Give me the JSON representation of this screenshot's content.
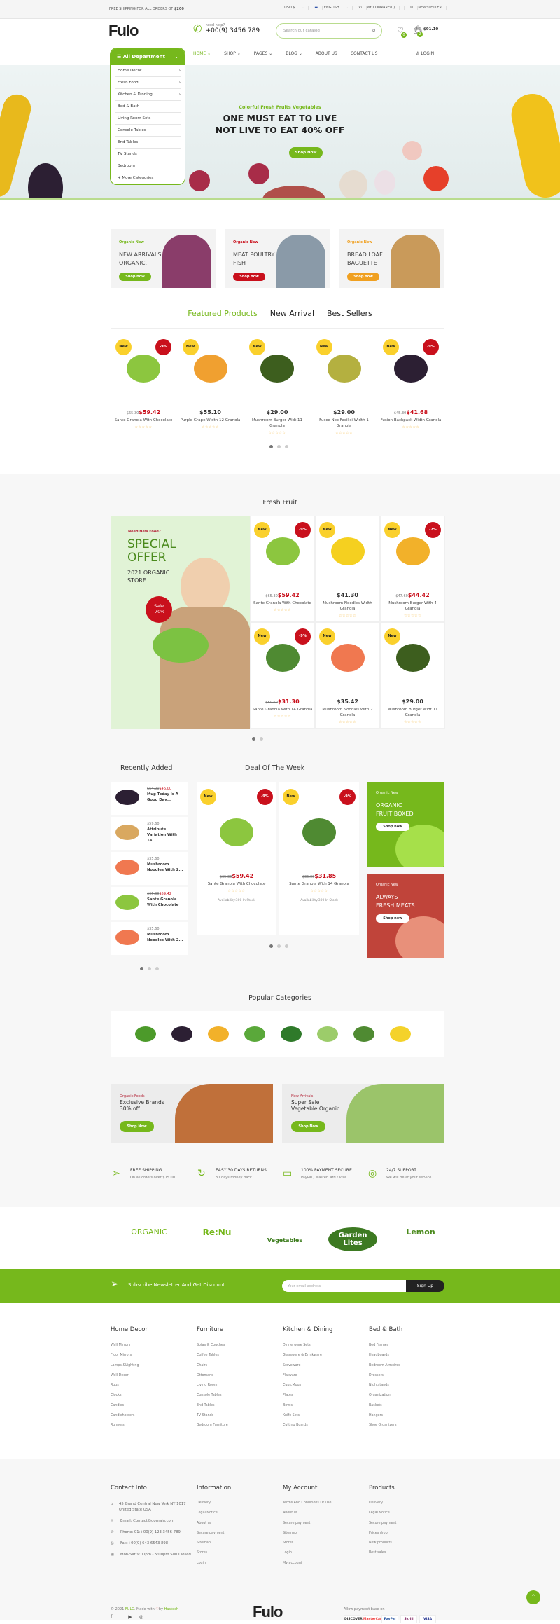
{
  "topbar": {
    "shipping_text": "FREE SHIPPING FOR ALL ORDERS OF",
    "shipping_amount": "$200",
    "currency": "USD $",
    "language": "ENGLISH",
    "compare": "MY COMPARE(0)",
    "newsletter": "NEWSLETTER"
  },
  "header": {
    "logo": "Fulo",
    "help_label": "need help?",
    "phone": "+00(9) 3456 789",
    "search_placeholder": "Search our catalog",
    "wishlist_count": "0",
    "cart_count": "2",
    "cart_total": "$91.10"
  },
  "nav": {
    "department": "All Department",
    "items": [
      "HOME",
      "SHOP",
      "PAGES",
      "BLOG",
      "ABOUT US",
      "CONTACT US"
    ],
    "dropdown": [
      true,
      true,
      true,
      true,
      false,
      false
    ],
    "login": "LOGIN"
  },
  "departments": [
    {
      "label": "Home Decor",
      "sub": true
    },
    {
      "label": "Fresh Food",
      "sub": true
    },
    {
      "label": "Kitchen & Dinning",
      "sub": true
    },
    {
      "label": "Bed & Bath"
    },
    {
      "label": "Living Room Sets"
    },
    {
      "label": "Console Tables"
    },
    {
      "label": "End Tables"
    },
    {
      "label": "TV Stands"
    },
    {
      "label": "Bedroom"
    },
    {
      "label": "+ More Categories"
    }
  ],
  "hero": {
    "subtitle": "Colorful Fresh Fruits Vegetables",
    "title_line1": "ONE MUST EAT TO LIVE",
    "title_line2": "NOT LIVE TO EAT 40% OFF",
    "button": "Shop Now"
  },
  "promos": [
    {
      "kicker": "Organic New",
      "title": "NEW ARRIVALS ORGANIC.",
      "button": "Shop now",
      "color": "#76b81c"
    },
    {
      "kicker": "Organic New",
      "title": "MEAT POULTRY FISH",
      "button": "Shop now",
      "color": "#c9101c"
    },
    {
      "kicker": "Organic New",
      "title": "BREAD LOAF BAGUETTE",
      "button": "Shop now",
      "color": "#f0a020"
    }
  ],
  "tabs": [
    {
      "label": "Featured Products",
      "active": true
    },
    {
      "label": "New Arrival"
    },
    {
      "label": "Best Sellers"
    }
  ],
  "featured": [
    {
      "badge": "New",
      "discount": "-9%",
      "old": "$65.30",
      "price": "$59.42",
      "name": "Sante Granola With Chocolate",
      "image": "lime"
    },
    {
      "badge": "New",
      "price": "$55.10",
      "name": "Purple Grape Width 12 Granola",
      "image": "papaya"
    },
    {
      "badge": "New",
      "price": "$29.00",
      "name": "Mushroom Burger Widt 11 Granola",
      "image": "avocado"
    },
    {
      "badge": "New",
      "price": "$29.00",
      "name": "Fusce Nec Facilisi Width 1 Granola",
      "image": "kiwi"
    },
    {
      "badge": "New",
      "discount": "-9%",
      "old": "$45.30",
      "price": "$41.68",
      "name": "Fusion Backpack Width Granola",
      "image": "eggplant"
    }
  ],
  "fresh_fruit": {
    "title": "Fresh Fruit",
    "banner": {
      "kicker": "Need New Food?",
      "title_line1": "SPECIAL",
      "title_line2": "OFFER",
      "subtitle_line1": "2021 ORGANIC",
      "subtitle_line2": "STORE",
      "sale_label": "Sale",
      "sale_value": "-70%"
    },
    "products": [
      {
        "badge": "New",
        "discount": "-9%",
        "old": "$65.30",
        "price": "$59.42",
        "name": "Sante Granola With Chocolate",
        "image": "lime"
      },
      {
        "badge": "New",
        "price": "$41.30",
        "name": "Mushroom Noodles Width Granola",
        "image": "lemon"
      },
      {
        "badge": "New",
        "discount": "-7%",
        "old": "$47.60",
        "price": "$44.42",
        "name": "Mushroom Burger With 4 Granola",
        "image": "mango"
      },
      {
        "badge": "New",
        "discount": "-9%",
        "old": "$50.60",
        "price": "$31.30",
        "name": "Sante Granola With 14 Granola",
        "image": "broccoli"
      },
      {
        "badge": "New",
        "price": "$35.42",
        "name": "Mushroom Noodles With 2 Granola",
        "image": "salmon"
      },
      {
        "badge": "New",
        "price": "$29.00",
        "name": "Mushroom Burger Widt 11 Granola",
        "image": "avocado"
      }
    ]
  },
  "recently_added": {
    "title": "Recently Added",
    "items": [
      {
        "old": "$54.00",
        "price": "$46.00",
        "name": "Mug Today Is A Good Day...",
        "image": "eggplant"
      },
      {
        "price": "$59.60",
        "name": "Attribute Variation With 14...",
        "image": "potato"
      },
      {
        "price": "$35.60",
        "name": "Mushroom Noodles With 2...",
        "image": "salmon"
      },
      {
        "old": "$65.30",
        "price": "$59.42",
        "name": "Sante Granola With Chocolate",
        "image": "lime"
      },
      {
        "price": "$35.60",
        "name": "Mushroom Noodles With 2...",
        "image": "salmon"
      }
    ]
  },
  "deal": {
    "title": "Deal Of The Week",
    "products": [
      {
        "badge": "New",
        "discount": "-9%",
        "old": "$65.30",
        "price": "$59.42",
        "name": "Sante Granola With Chocolate",
        "availability": "Availability:300 In Stock",
        "image": "lime"
      },
      {
        "badge": "New",
        "discount": "-9%",
        "old": "$35.00",
        "price": "$31.85",
        "name": "Sante Granola With 14 Granola",
        "availability": "Availability:300 In Stock",
        "image": "broccoli"
      }
    ]
  },
  "side_banners": [
    {
      "kicker": "Organic New",
      "line1": "ORGANIC",
      "line2": "FRUIT BOXED",
      "button": "Shop now",
      "color": "#76b81c"
    },
    {
      "kicker": "Organic New",
      "line1": "ALWAYS",
      "line2": "FRESH MEATS",
      "button": "Shop now",
      "color": "#c0443a"
    }
  ],
  "popular": {
    "title": "Popular Categories",
    "items": [
      "cucumber",
      "eggplant",
      "mango",
      "peas",
      "herbs",
      "custard-apple",
      "broccoli",
      "banana"
    ]
  },
  "wide_banners": [
    {
      "kicker": "Organic Foods",
      "line1": "Exclusive Brands",
      "line2": "30% off",
      "button": "Shop Now"
    },
    {
      "kicker": "New Arrivals",
      "line1": "Super Sale",
      "line2": "Vegetable Organic",
      "button": "Shop Now"
    }
  ],
  "features": [
    {
      "icon": "paper-plane",
      "title": "FREE SHIPPING",
      "desc": "On all orders over $75.00"
    },
    {
      "icon": "rotate",
      "title": "EASY 30 DAYS RETURNS",
      "desc": "30 days money back"
    },
    {
      "icon": "credit-card",
      "title": "100% PAYMENT SECURE",
      "desc": "PayPal / MasterCard / Visa"
    },
    {
      "icon": "lifebuoy",
      "title": "24/7 SUPPORT",
      "desc": "We will be at your service"
    }
  ],
  "brands": [
    "ORGANIC",
    "Re:Nu",
    "Vegetables",
    "Garden Lites",
    "Lemon"
  ],
  "newsletter": {
    "title": "Subscribe Newsletter And Get Discount",
    "placeholder": "Your email address",
    "button": "Sign Up"
  },
  "footer_columns": [
    {
      "title": "Home Decor",
      "links": [
        "Wall Mirrors",
        "Floor Mirrors",
        "Lamps &Lighting",
        "Wall Decor",
        "Rugs",
        "Clocks",
        "Candles",
        "Candleholders",
        "Runners"
      ]
    },
    {
      "title": "Furniture",
      "links": [
        "Sofas & Couches",
        "Coffee Tables",
        "Chairs",
        "Ottomans",
        "Living Room",
        "Console Tables",
        "End Tables",
        "TV Stands",
        "Bedroom Furniture"
      ]
    },
    {
      "title": "Kitchen & Dining",
      "links": [
        "Dinnerware Sets",
        "Glassware & Drinkware",
        "Serveware",
        "Flatware",
        "Cups,Mugs",
        "Plates",
        "Bowls",
        "Knife Sets",
        "Cutting Boards"
      ]
    },
    {
      "title": "Bed & Bath",
      "links": [
        "Bed Frames",
        "Headboards",
        "Bedroom Armoires",
        "Dressers",
        "Nightstands",
        "Organization",
        "Baskets",
        "Hangers",
        "Shoe Organizers"
      ]
    }
  ],
  "contact": {
    "title": "Contact Info",
    "items": [
      {
        "icon": "home",
        "text": "45 Grand Central New York NY 1017 United State USA"
      },
      {
        "icon": "mail",
        "text": "Email: Contact@domain.com"
      },
      {
        "icon": "phone",
        "text": "Phone: 01:+00(9) 123 3456 789"
      },
      {
        "icon": "printer",
        "text": "Fax:+00(9) 643 6543 898"
      },
      {
        "icon": "calendar",
        "text": "Mon-Sat 9:00pm - 5:00pm Sun:Closed"
      }
    ]
  },
  "link_columns": [
    {
      "title": "Information",
      "links": [
        "Delivery",
        "Legal Notice",
        "About us",
        "Secure payment",
        "Sitemap",
        "Stores",
        "Login"
      ]
    },
    {
      "title": "My Account",
      "links": [
        "Terms And Conditions Of Use",
        "About us",
        "Secure payment",
        "Sitemap",
        "Stores",
        "Login",
        "My account"
      ]
    },
    {
      "title": "Products",
      "links": [
        "Delivery",
        "Legal Notice",
        "Secure payment",
        "Prices drop",
        "New products",
        "Best sales"
      ]
    }
  ],
  "bottom": {
    "copyright": "© 2021",
    "brand": "FULO",
    "made_with": ". Made with",
    "by": "by",
    "author": "Hastech",
    "logo": "Fulo",
    "payment_label": "Allow payment base on",
    "payments": [
      "DISCOVER",
      "MasterCard",
      "PayPal",
      "Skrill",
      "VISA"
    ],
    "socials": [
      "facebook",
      "twitter",
      "youtube",
      "instagram"
    ]
  },
  "colors": {
    "accent": "#76b81c",
    "sale": "#c9101c",
    "badge_new": "#fad02c"
  }
}
